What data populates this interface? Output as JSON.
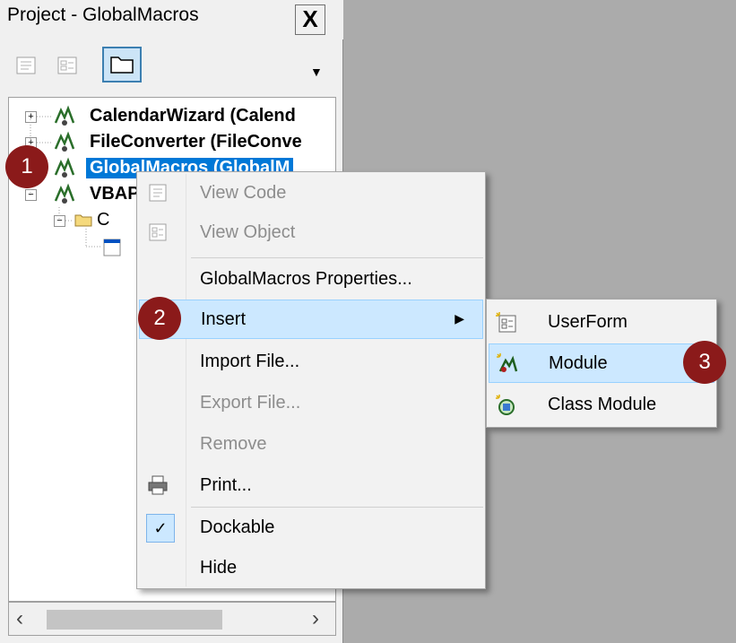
{
  "panel": {
    "title": "Project - GlobalMacros",
    "close_glyph": "X"
  },
  "tree": {
    "items": [
      {
        "label": "CalendarWizard (Calend"
      },
      {
        "label": "FileConverter (FileConve"
      },
      {
        "label": "GlobalMacros (GlobalM"
      },
      {
        "label": "VBAP"
      },
      {
        "label": "C"
      }
    ]
  },
  "context_menu": {
    "items": [
      {
        "label": "View Code",
        "disabled": true
      },
      {
        "label": "View Object",
        "disabled": true
      },
      {
        "label": "GlobalMacros Properties...",
        "disabled": false
      },
      {
        "label": "Insert",
        "disabled": false,
        "highlighted": true
      },
      {
        "label": "Import File...",
        "disabled": false
      },
      {
        "label": "Export File...",
        "disabled": true
      },
      {
        "label": "Remove",
        "disabled": true
      },
      {
        "label": "Print...",
        "disabled": false
      },
      {
        "label": "Dockable",
        "disabled": false,
        "checked": true
      },
      {
        "label": "Hide",
        "disabled": false
      }
    ]
  },
  "submenu": {
    "items": [
      {
        "label": "UserForm"
      },
      {
        "label": "Module",
        "highlighted": true
      },
      {
        "label": "Class Module"
      }
    ]
  },
  "badges": [
    "1",
    "2",
    "3"
  ],
  "colors": {
    "badge": "#8b1a1a",
    "selection": "#0078d7",
    "menu_highlight": "#cce8ff"
  }
}
